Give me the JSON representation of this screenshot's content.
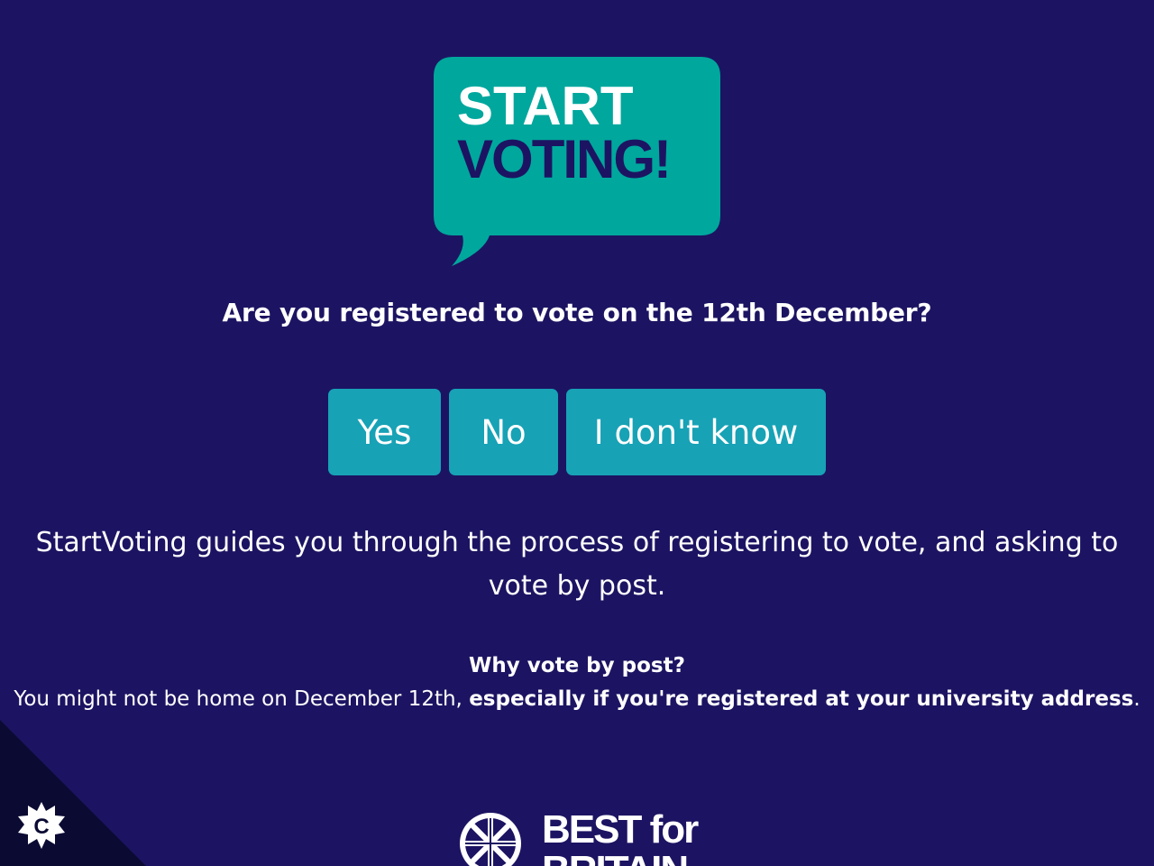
{
  "logo": {
    "line1": "START",
    "line2": "VOTING!",
    "icon": "speech-bubble-icon",
    "colors": {
      "bubble": "#00a79d",
      "line1": "#ffffff",
      "line2": "#1c1462"
    }
  },
  "question": "Are you registered to vote on the 12th December?",
  "buttons": {
    "yes": "Yes",
    "no": "No",
    "dont_know": "I don't know"
  },
  "intro": "StartVoting guides you through the process of registering to vote, and asking to vote by post.",
  "why": {
    "title": "Why vote by post?",
    "text_plain": "You might not be home on December 12th, ",
    "text_bold": "especially if you're registered at your university address",
    "text_end": "."
  },
  "cookie_button": {
    "label": "C",
    "icon": "cookie-settings-icon"
  },
  "footer_logo": {
    "line1": "BEST for",
    "line2": "BRITAIN",
    "icon": "union-jack-circle-icon"
  },
  "colors": {
    "background": "#1c1462",
    "button": "#17a2b6",
    "text": "#ffffff",
    "corner": "#0b0a33"
  }
}
